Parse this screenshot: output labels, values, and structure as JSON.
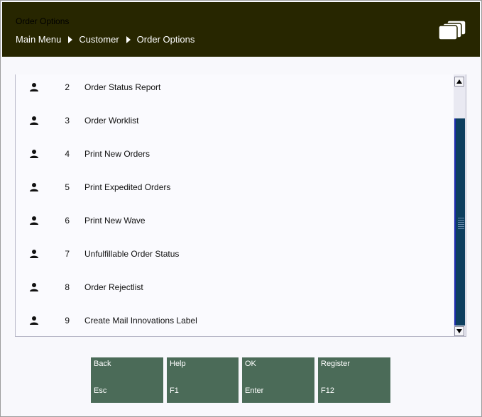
{
  "header": {
    "window_title": "Order Options",
    "breadcrumb": [
      "Main Menu",
      "Customer",
      "Order Options"
    ],
    "icon": "windows-icon"
  },
  "menu": {
    "items": [
      {
        "num": "2",
        "label": "Order Status Report",
        "icon": "person-icon"
      },
      {
        "num": "3",
        "label": "Order Worklist",
        "icon": "person-icon"
      },
      {
        "num": "4",
        "label": "Print New Orders",
        "icon": "person-icon"
      },
      {
        "num": "5",
        "label": "Print Expedited Orders",
        "icon": "person-icon"
      },
      {
        "num": "6",
        "label": "Print New Wave",
        "icon": "person-icon"
      },
      {
        "num": "7",
        "label": "Unfulfillable Order Status",
        "icon": "person-icon"
      },
      {
        "num": "8",
        "label": "Order Rejectlist",
        "icon": "person-icon"
      },
      {
        "num": "9",
        "label": "Create Mail Innovations Label",
        "icon": "person-icon"
      }
    ]
  },
  "function_keys": [
    {
      "label": "Back",
      "key": "Esc"
    },
    {
      "label": "Help",
      "key": "F1"
    },
    {
      "label": "OK",
      "key": "Enter"
    },
    {
      "label": "Register",
      "key": "F12"
    }
  ],
  "colors": {
    "header_bg": "#272600",
    "fkey_bg": "#4b6b58",
    "scroll_thumb": "#0d3f5f"
  }
}
